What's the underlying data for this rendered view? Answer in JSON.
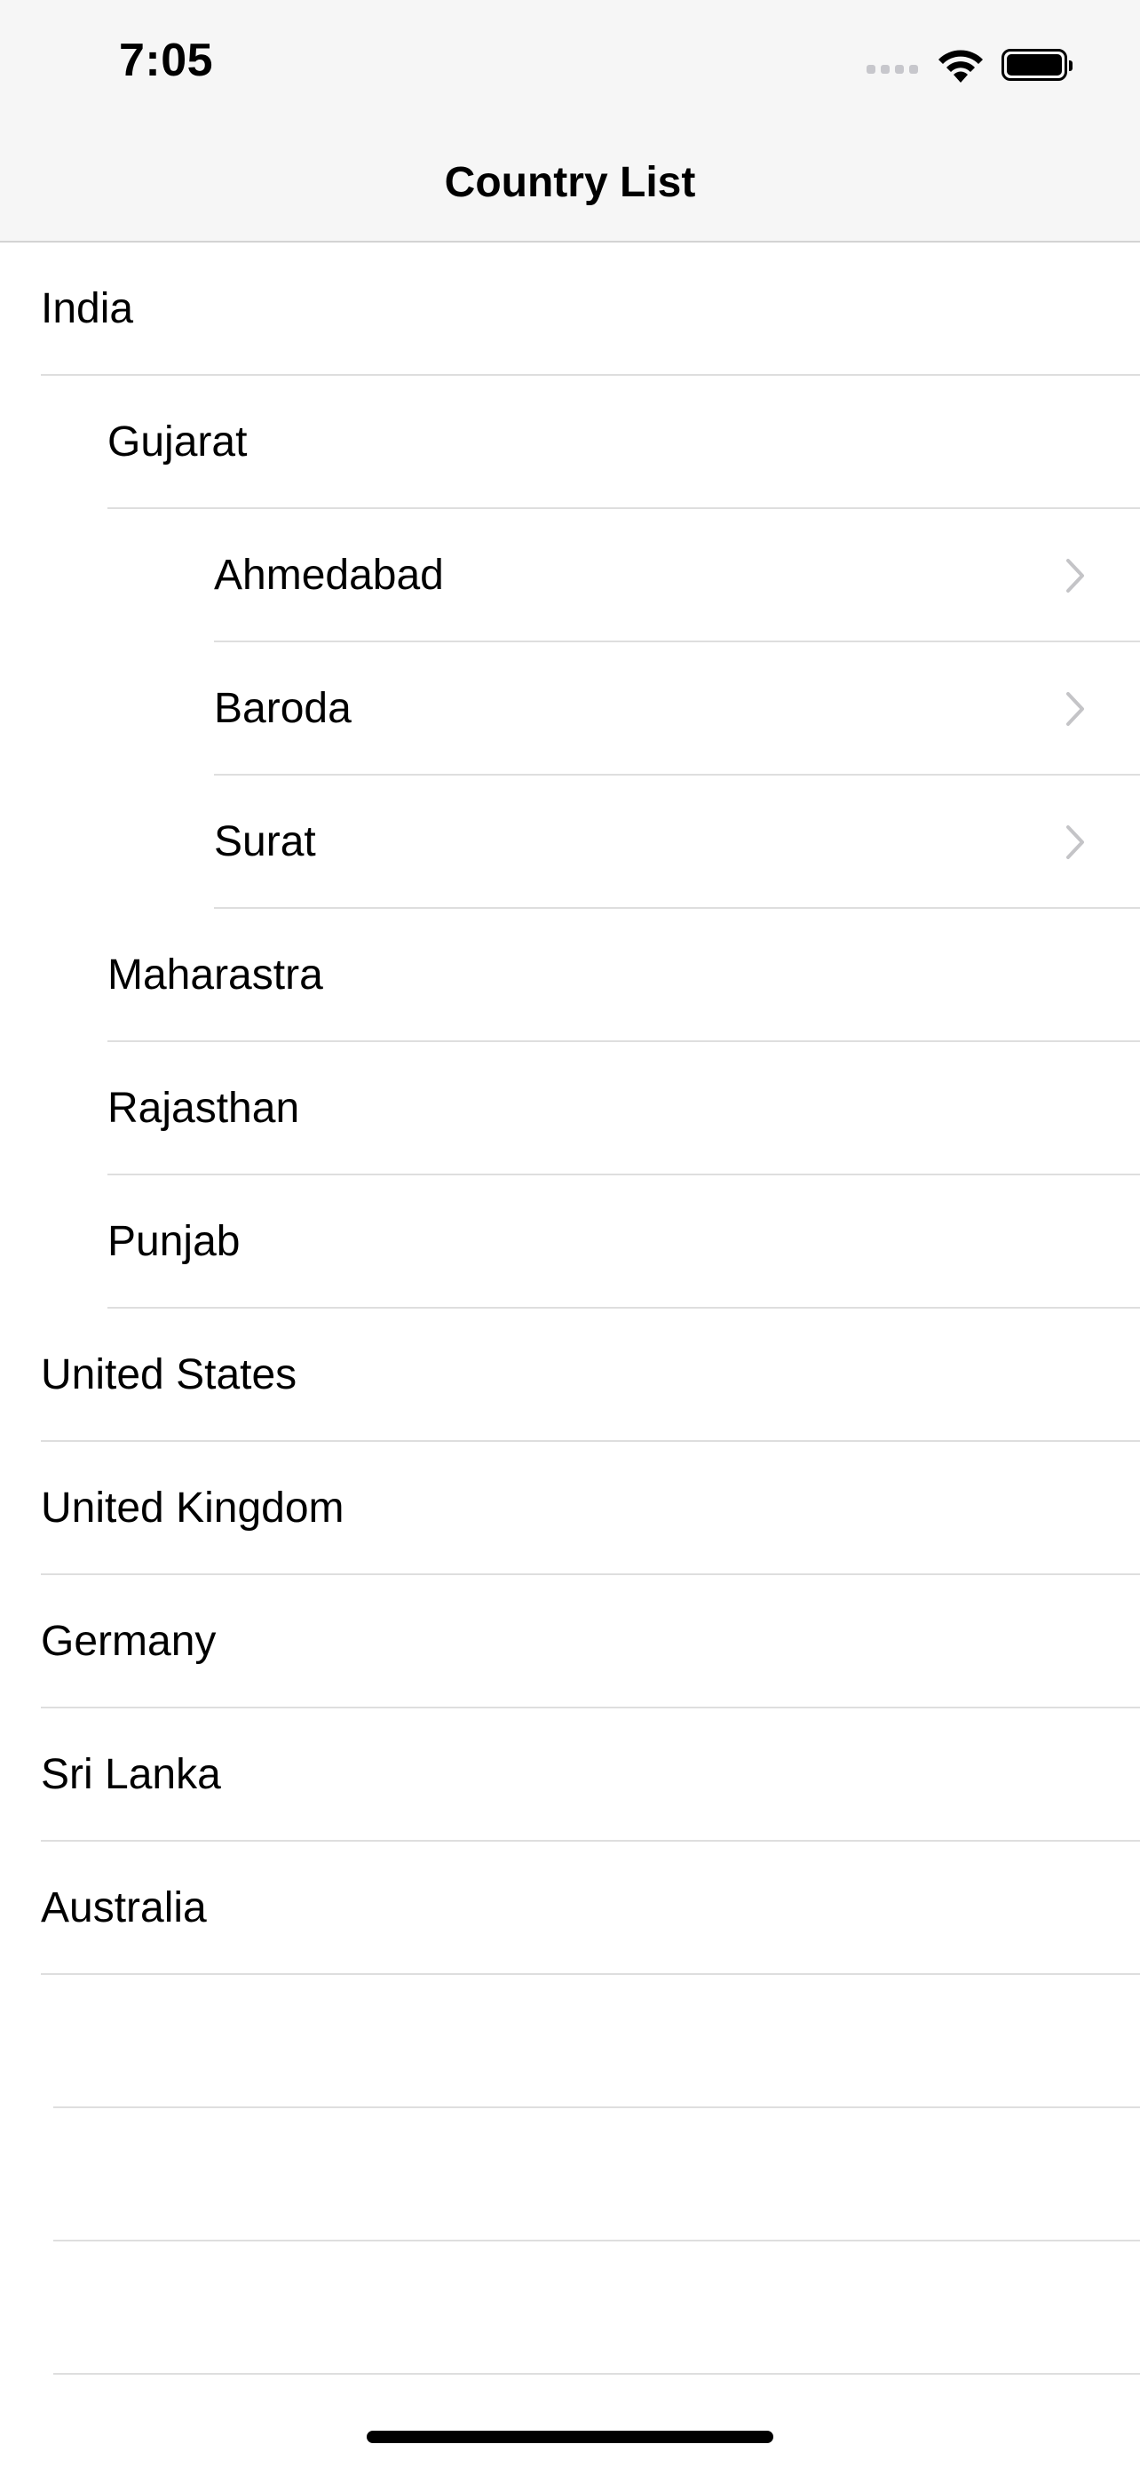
{
  "status_bar": {
    "time": "7:05",
    "signal_icon": "cellular-signal-icon",
    "wifi_icon": "wifi-icon",
    "battery_icon": "battery-icon",
    "battery_level": 1.0
  },
  "nav": {
    "title": "Country List"
  },
  "list": {
    "items": [
      {
        "label": "India",
        "level": 0,
        "chevron": false
      },
      {
        "label": "Gujarat",
        "level": 1,
        "chevron": false
      },
      {
        "label": "Ahmedabad",
        "level": 2,
        "chevron": true
      },
      {
        "label": "Baroda",
        "level": 2,
        "chevron": true
      },
      {
        "label": "Surat",
        "level": 2,
        "chevron": true
      },
      {
        "label": "Maharastra",
        "level": 1,
        "chevron": false
      },
      {
        "label": "Rajasthan",
        "level": 1,
        "chevron": false
      },
      {
        "label": "Punjab",
        "level": 1,
        "chevron": false
      },
      {
        "label": "United States",
        "level": 0,
        "chevron": false
      },
      {
        "label": "United Kingdom",
        "level": 0,
        "chevron": false
      },
      {
        "label": "Germany",
        "level": 0,
        "chevron": false
      },
      {
        "label": "Sri Lanka",
        "level": 0,
        "chevron": false
      },
      {
        "label": "Australia",
        "level": 0,
        "chevron": false
      }
    ],
    "chevron_icon": "chevron-right-icon"
  },
  "colors": {
    "nav_background": "#f6f6f6",
    "separator": "#dedede",
    "chevron": "#c4c4c7",
    "signal_inactive": "#c7c7cc"
  }
}
